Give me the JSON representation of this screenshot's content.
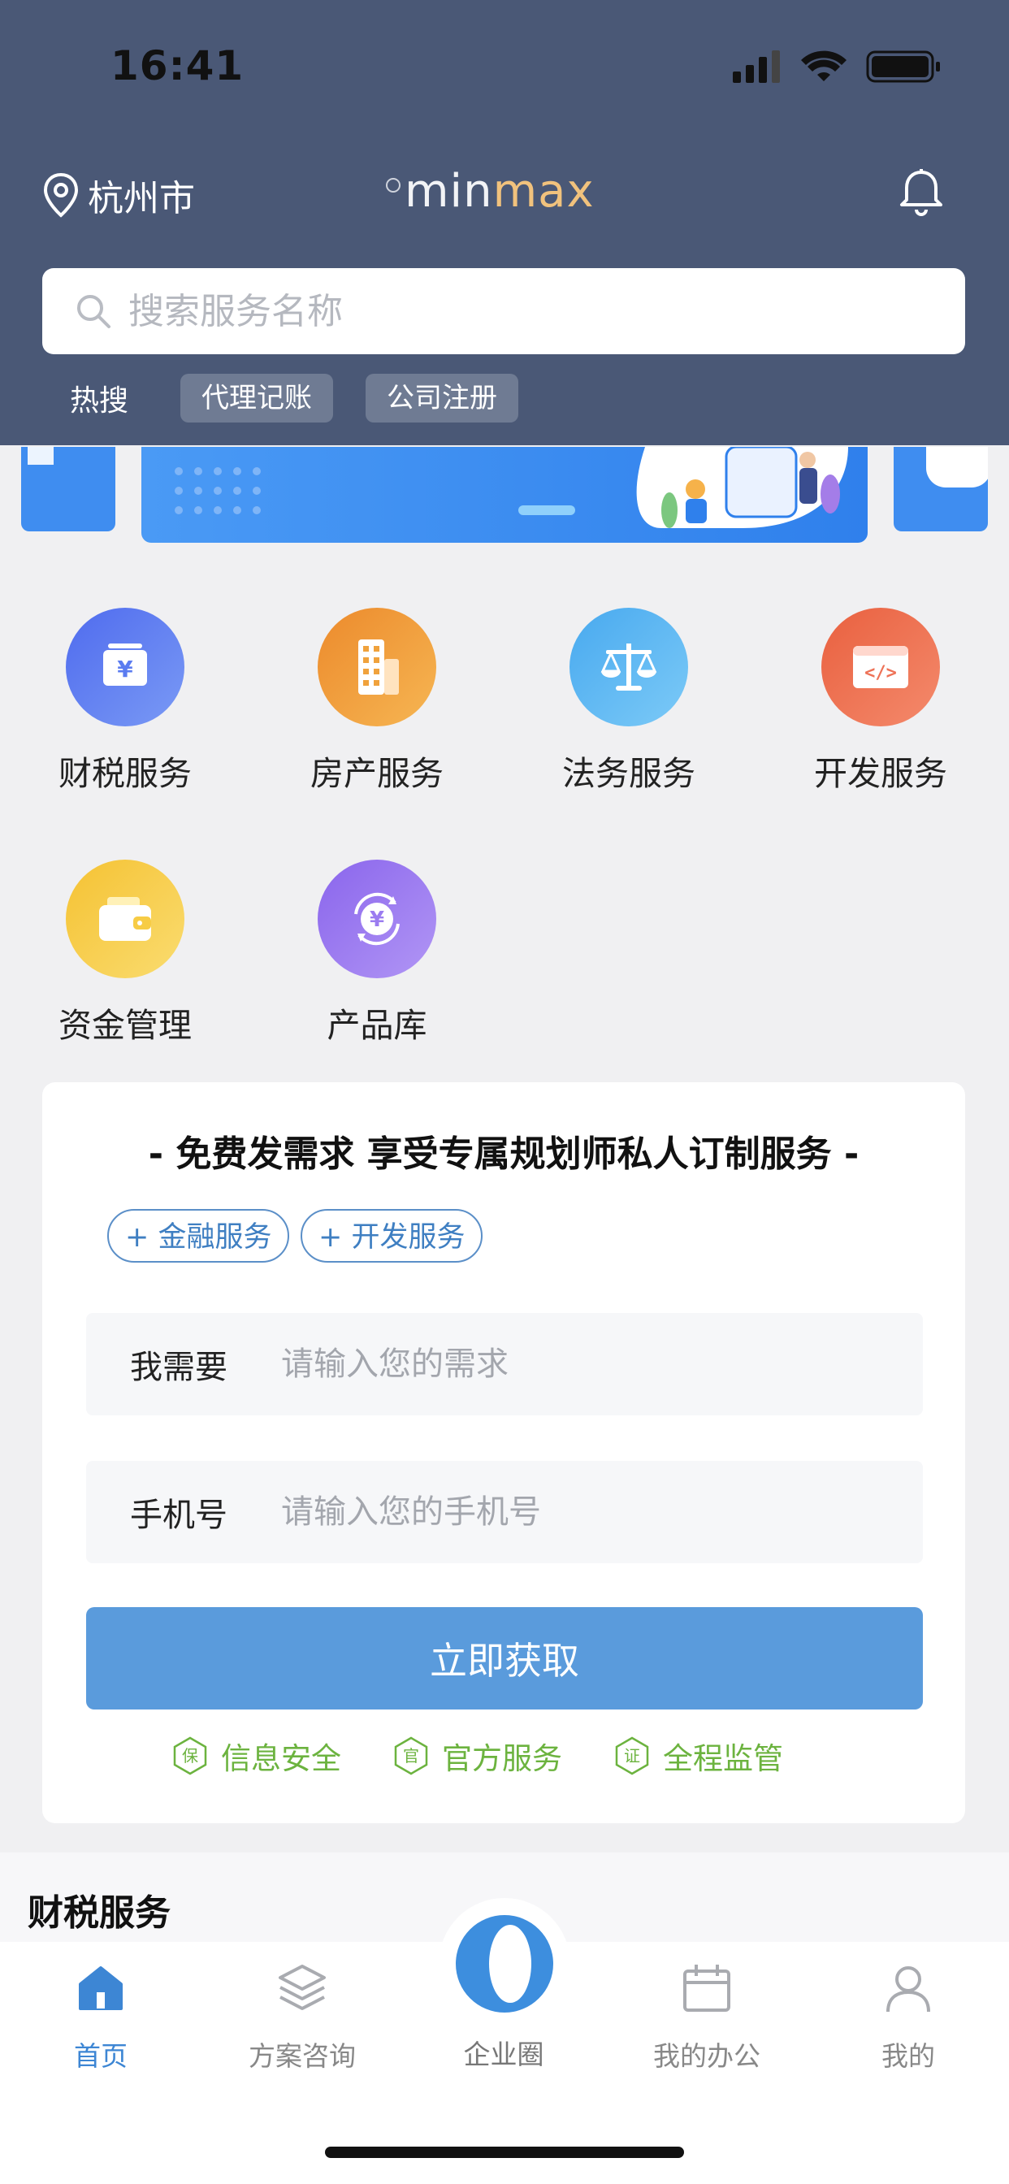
{
  "status_bar": {
    "time": "16:41"
  },
  "header": {
    "city": "杭州市",
    "logo_text": "minmax",
    "search_placeholder": "搜索服务名称",
    "hot_label": "热搜",
    "hot_tags": [
      "代理记账",
      "公司注册"
    ]
  },
  "services": [
    {
      "label": "财税服务",
      "icon": "tax-icon",
      "color": "#5b7cf0"
    },
    {
      "label": "房产服务",
      "icon": "building-icon",
      "color": "#f0a23c"
    },
    {
      "label": "法务服务",
      "icon": "scale-icon",
      "color": "#5bb6f2"
    },
    {
      "label": "开发服务",
      "icon": "code-icon",
      "color": "#ee7257"
    },
    {
      "label": "资金管理",
      "icon": "wallet-icon",
      "color": "#f7cc45"
    },
    {
      "label": "产品库",
      "icon": "yuan-cycle-icon",
      "color": "#9b7cf0"
    }
  ],
  "demand_card": {
    "title": "- 免费发需求 享受专属规划师私人订制服务 -",
    "chips": [
      "+ 金融服务",
      "+ 开发服务"
    ],
    "need_label": "我需要",
    "need_placeholder": "请输入您的需求",
    "phone_label": "手机号",
    "phone_placeholder": "请输入您的手机号",
    "submit_label": "立即获取",
    "assurances": [
      {
        "badge": "保",
        "label": "信息安全"
      },
      {
        "badge": "官",
        "label": "官方服务"
      },
      {
        "badge": "证",
        "label": "全程监管"
      }
    ],
    "accent_color": "#5a9bdc",
    "assure_color": "#6cb33f"
  },
  "section": {
    "title": "财税服务"
  },
  "tabbar": {
    "items": [
      {
        "label": "首页",
        "icon": "home-icon",
        "active": true
      },
      {
        "label": "方案咨询",
        "icon": "layers-icon",
        "active": false
      },
      {
        "label": "企业圈",
        "icon": "circle-o-icon",
        "active": false
      },
      {
        "label": "我的办公",
        "icon": "calendar-icon",
        "active": false
      },
      {
        "label": "我的",
        "icon": "user-icon",
        "active": false
      }
    ]
  }
}
